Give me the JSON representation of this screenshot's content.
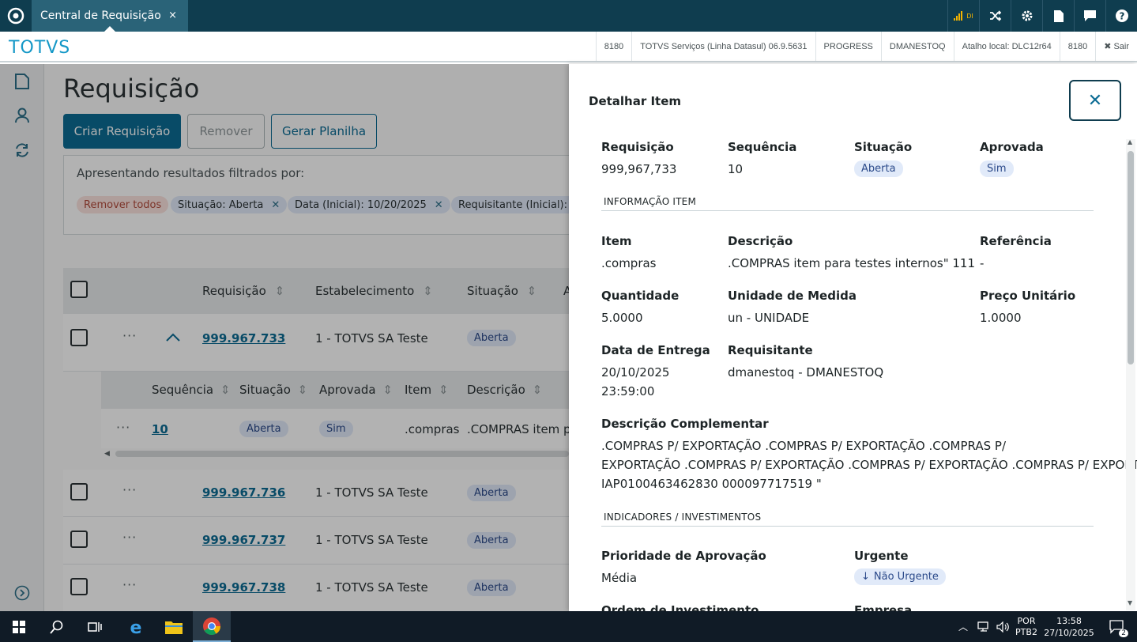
{
  "window": {
    "tab_title": "Central de Requisição",
    "tab_close": "×"
  },
  "topbar": {
    "icons": [
      "signal-icon",
      "shuffle-icon",
      "gear-icon",
      "document-icon",
      "chat-icon",
      "help-icon"
    ],
    "signal_label": "DI"
  },
  "brand": "TOTVS",
  "infobar": [
    "8180",
    "TOTVS Serviços (Linha Datasul) 06.9.5631",
    "PROGRESS",
    "DMANESTOQ",
    "Atalho local: DLC12r64",
    "8180"
  ],
  "logout": "Sair",
  "page": {
    "title": "Requisição",
    "buttons": {
      "create": "Criar Requisição",
      "remove": "Remover",
      "spreadsheet": "Gerar Planilha"
    },
    "filters": {
      "label": "Apresentando resultados filtrados por:",
      "remove_all": "Remover todos",
      "chips": [
        "Situação: Aberta",
        "Data (Inicial): 10/20/2025",
        "Requisitante (Inicial): d"
      ]
    },
    "columns": [
      "Requisição",
      "Estabelecimento",
      "Situação",
      "A"
    ],
    "rows": [
      {
        "id": "999.967.733",
        "estab": "1 - TOTVS SA Teste",
        "situacao": "Aberta"
      },
      {
        "id": "999.967.736",
        "estab": "1 - TOTVS SA Teste",
        "situacao": "Aberta"
      },
      {
        "id": "999.967.737",
        "estab": "1 - TOTVS SA Teste",
        "situacao": "Aberta"
      },
      {
        "id": "999.967.738",
        "estab": "1 - TOTVS SA Teste",
        "situacao": "Aberta"
      }
    ],
    "sub_columns": [
      "Sequência",
      "Situação",
      "Aprovada",
      "Item",
      "Descrição"
    ],
    "sub_row": {
      "seq": "10",
      "situacao": "Aberta",
      "aprovada": "Sim",
      "item": ".compras",
      "descricao": ".COMPRAS item pa"
    }
  },
  "panel": {
    "title": "Detalhar Item",
    "requisicao": {
      "label": "Requisição",
      "value": "999,967,733"
    },
    "sequencia": {
      "label": "Sequência",
      "value": "10"
    },
    "situacao": {
      "label": "Situação",
      "value": "Aberta"
    },
    "aprovada": {
      "label": "Aprovada",
      "value": "Sim"
    },
    "section_item": "INFORMAÇÃO ITEM",
    "item": {
      "label": "Item",
      "value": ".compras"
    },
    "descricao": {
      "label": "Descrição",
      "value": ".COMPRAS item para testes internos\" 111"
    },
    "referencia": {
      "label": "Referência",
      "value": "-"
    },
    "quantidade": {
      "label": "Quantidade",
      "value": "5.0000"
    },
    "unidade": {
      "label": "Unidade de Medida",
      "value": "un - UNIDADE"
    },
    "preco": {
      "label": "Preço Unitário",
      "value": "1.0000"
    },
    "entrega": {
      "label": "Data de Entrega",
      "date": "20/10/2025",
      "time": "23:59:00"
    },
    "requisitante": {
      "label": "Requisitante",
      "value": "dmanestoq - DMANESTOQ"
    },
    "desc_comp": {
      "label": "Descrição Complementar",
      "line1": ".COMPRAS P/ EXPORTAÇÃO .COMPRAS P/ EXPORTAÇÃO .COMPRAS P/",
      "line2": "EXPORTAÇÃO .COMPRAS P/ EXPORTAÇÃO .COMPRAS P/ EXPORTAÇÃO .COMPRAS P/ EXPORTAÇÃO",
      "line3": "IAP0100463462830 000097717519 \""
    },
    "section_ind": "INDICADORES / INVESTIMENTOS",
    "prioridade": {
      "label": "Prioridade de Aprovação",
      "value": "Média"
    },
    "urgente": {
      "label": "Urgente",
      "value": "Não Urgente"
    },
    "ordem": {
      "label": "Ordem de Investimento"
    },
    "empresa": {
      "label": "Empresa"
    }
  },
  "taskbar": {
    "lang1": "POR",
    "lang2": "PTB2",
    "time": "13:58",
    "date": "27/10/2025",
    "notif": "2"
  }
}
